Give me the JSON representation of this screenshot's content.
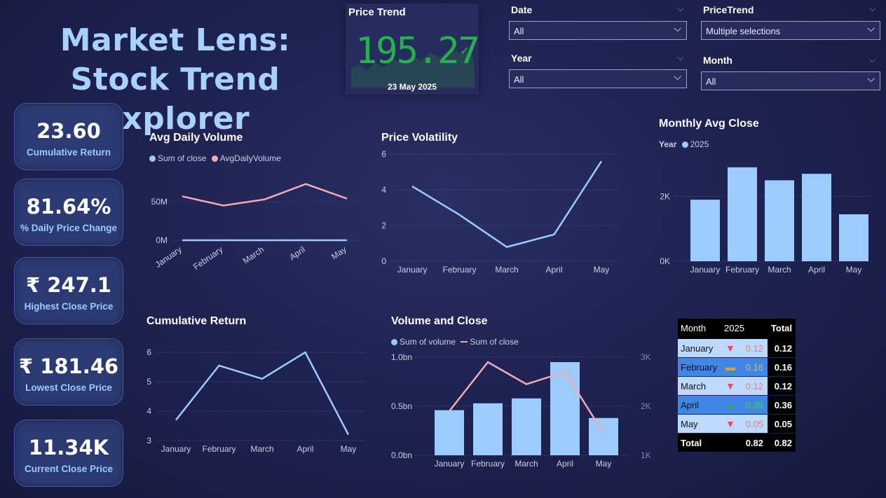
{
  "title": "Market Lens: Stock Trend Explorer",
  "kpis": [
    {
      "value": "23.60",
      "label": "Cumulative Return"
    },
    {
      "value": "81.64%",
      "label": "% Daily Price Change"
    },
    {
      "value": "₹ 247.1",
      "label": "Highest Close Price"
    },
    {
      "value": "₹ 181.46",
      "label": "Lowest Close Price"
    },
    {
      "value": "11.34K",
      "label": "Current Close Price"
    }
  ],
  "price_trend": {
    "title": "Price Trend",
    "value": "195.27",
    "date": "23 May 2025",
    "check_icon": "check-icon"
  },
  "slicers": {
    "date": {
      "label": "Date",
      "value": "All"
    },
    "pricetrend": {
      "label": "PriceTrend",
      "value": "Multiple selections"
    },
    "year": {
      "label": "Year",
      "value": "All"
    },
    "month": {
      "label": "Month",
      "value": "All"
    }
  },
  "colors": {
    "blue": "#9ccbff",
    "pink": "#f4aab7",
    "green": "#26b24a",
    "red": "#f07b7b",
    "accent": "#3f86e6"
  },
  "chart_data": [
    {
      "type": "line",
      "title": "Avg Daily Volume",
      "legend": [
        "Sum of close",
        "AvgDailyVolume"
      ],
      "categories": [
        "January",
        "February",
        "March",
        "April",
        "May"
      ],
      "yticks": [
        "0M",
        "50M"
      ],
      "series": [
        {
          "name": "Sum of close",
          "values": [
            0.004,
            0.004,
            0.004,
            0.004,
            0.004
          ]
        },
        {
          "name": "AvgDailyVolume",
          "values": [
            57,
            45,
            53,
            73,
            54
          ]
        }
      ],
      "ylim": [
        0,
        80
      ],
      "unit": "M"
    },
    {
      "type": "line",
      "title": "Price Volatility",
      "categories": [
        "January",
        "February",
        "March",
        "April",
        "May"
      ],
      "yticks": [
        "0",
        "2",
        "4",
        "6"
      ],
      "series": [
        {
          "values": [
            4.2,
            2.6,
            0.8,
            1.5,
            5.6
          ]
        }
      ],
      "ylim": [
        0,
        6
      ]
    },
    {
      "type": "bar",
      "title": "Monthly Avg Close",
      "legend_title": "Year",
      "legend": [
        "2025"
      ],
      "categories": [
        "January",
        "February",
        "March",
        "April",
        "May"
      ],
      "yticks": [
        "0K",
        "2K"
      ],
      "series": [
        {
          "name": "2025",
          "values": [
            1.9,
            2.9,
            2.5,
            2.7,
            1.45
          ]
        }
      ],
      "ylim": [
        0,
        3.2
      ],
      "unit": "K"
    },
    {
      "type": "line",
      "title": "Cumulative Return",
      "categories": [
        "January",
        "February",
        "March",
        "April",
        "May"
      ],
      "yticks": [
        "3",
        "4",
        "5",
        "6"
      ],
      "series": [
        {
          "values": [
            3.7,
            5.55,
            5.1,
            6.0,
            3.2
          ]
        }
      ],
      "ylim": [
        3,
        6
      ]
    },
    {
      "type": "bar",
      "title": "Volume and Close",
      "legend": [
        "Sum of volume",
        "Sum of close"
      ],
      "categories": [
        "January",
        "February",
        "March",
        "April",
        "May"
      ],
      "yticks_left": [
        "0.0bn",
        "0.5bn",
        "1.0bn"
      ],
      "yticks_right": [
        "1K",
        "2K",
        "3K"
      ],
      "series": [
        {
          "name": "Sum of volume",
          "values": [
            0.46,
            0.53,
            0.58,
            0.95,
            0.38
          ],
          "unit": "bn"
        },
        {
          "name": "Sum of close",
          "values": [
            1.9,
            2.9,
            2.45,
            2.7,
            1.45
          ],
          "unit": "K"
        }
      ],
      "ylim_left": [
        0,
        1.0
      ],
      "ylim_right": [
        1,
        3
      ]
    }
  ],
  "matrix": {
    "headers": [
      "Month",
      "2025",
      "Total"
    ],
    "rows": [
      {
        "month": "January",
        "value": "0.12",
        "total": "0.12",
        "icon": "down"
      },
      {
        "month": "February",
        "value": "0.16",
        "total": "0.16",
        "icon": "flat"
      },
      {
        "month": "March",
        "value": "0.12",
        "total": "0.12",
        "icon": "down"
      },
      {
        "month": "April",
        "value": "0.36",
        "total": "0.36",
        "icon": "up"
      },
      {
        "month": "May",
        "value": "0.05",
        "total": "0.05",
        "icon": "down"
      }
    ],
    "total": {
      "label": "Total",
      "value": "0.82",
      "total": "0.82"
    }
  }
}
